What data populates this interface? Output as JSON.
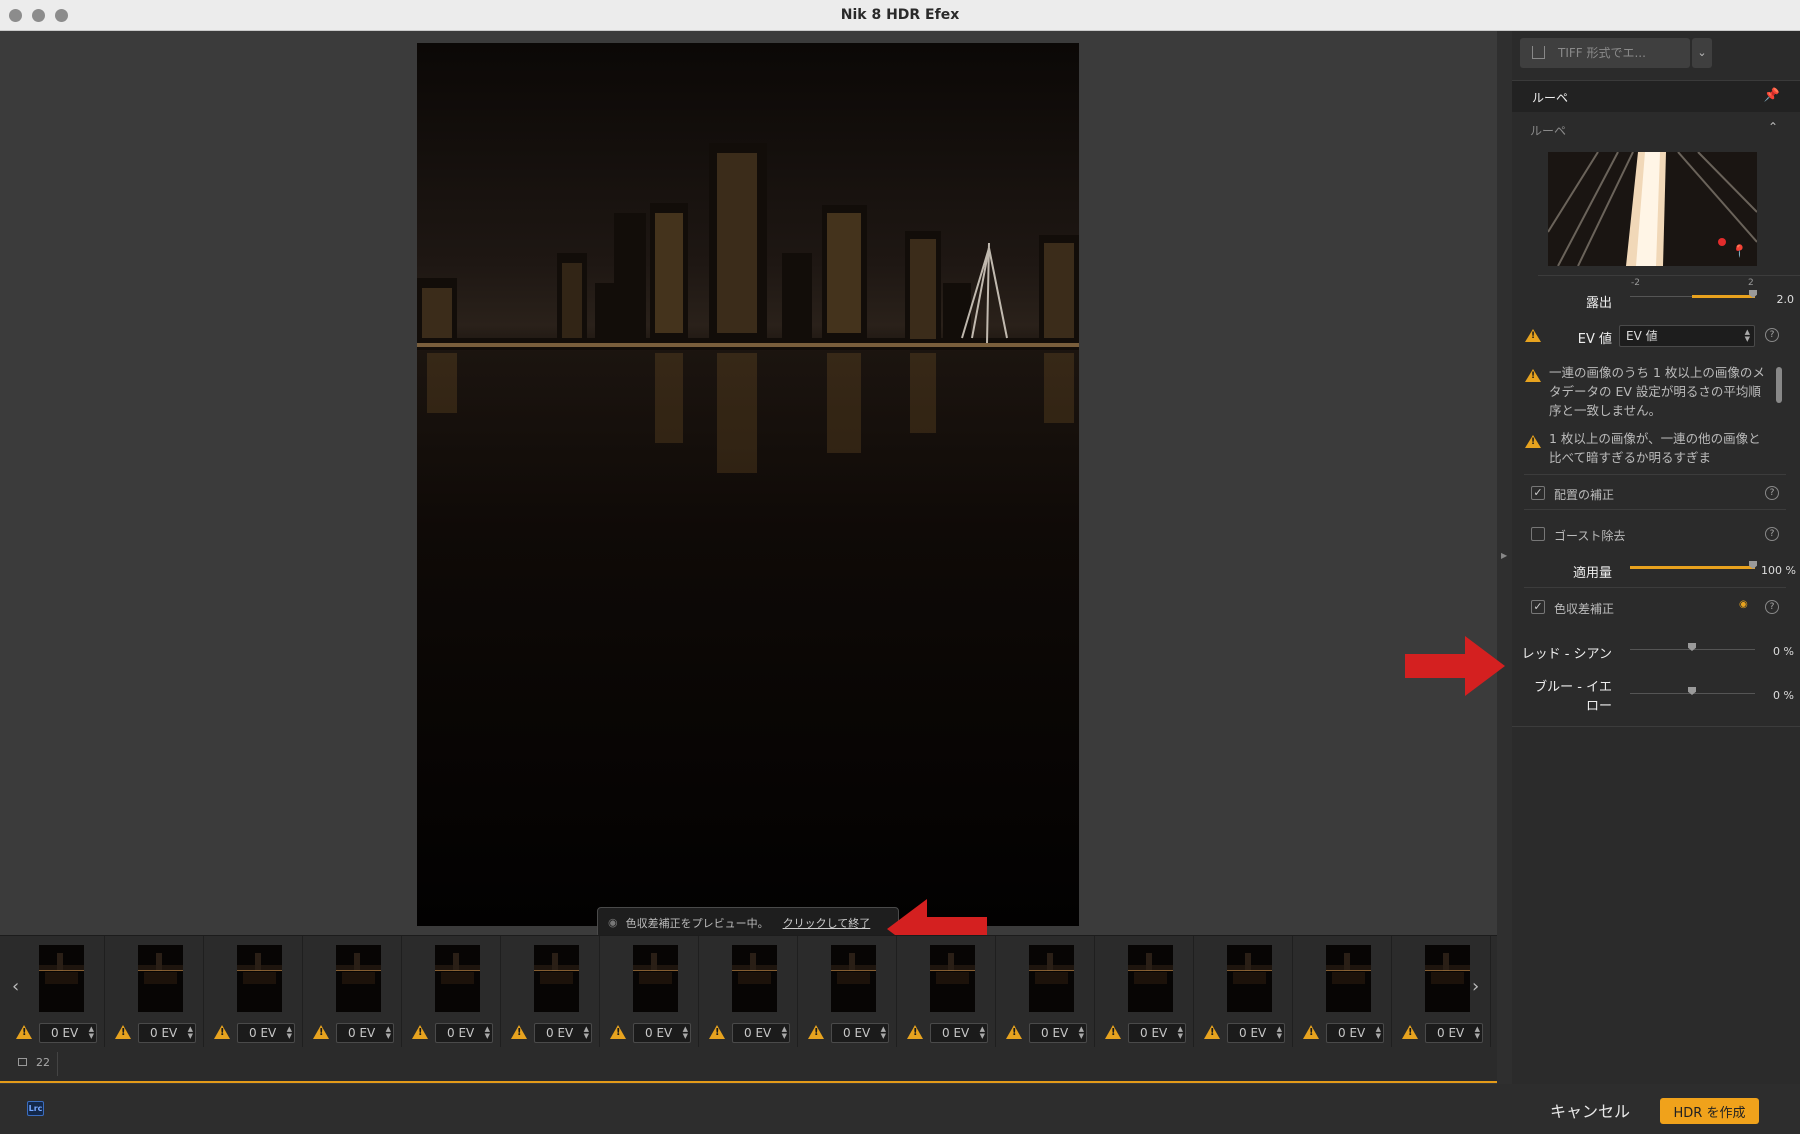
{
  "window": {
    "title": "Nik 8 HDR Efex"
  },
  "preview_notice": {
    "text": "色収差補正をプレビュー中。",
    "link": "クリックして終了"
  },
  "filmstrip": {
    "frames": [
      {
        "ev": "0 EV"
      },
      {
        "ev": "0 EV"
      },
      {
        "ev": "0 EV"
      },
      {
        "ev": "0 EV"
      },
      {
        "ev": "0 EV"
      },
      {
        "ev": "0 EV"
      },
      {
        "ev": "0 EV"
      },
      {
        "ev": "0 EV"
      },
      {
        "ev": "0 EV"
      },
      {
        "ev": "0 EV"
      },
      {
        "ev": "0 EV"
      },
      {
        "ev": "0 EV"
      },
      {
        "ev": "0 EV"
      },
      {
        "ev": "0 EV"
      },
      {
        "ev": "0 EV"
      }
    ]
  },
  "status": {
    "image_count": "22"
  },
  "bottom": {
    "lrc_badge": "Lrc",
    "cancel_label": "キャンセル",
    "create_label": "HDR を作成"
  },
  "panel": {
    "export_label": "TIFF 形式でエ...",
    "header_title": "ルーペ",
    "loupe_section": "ルーペ",
    "exposure": {
      "label": "露出",
      "min_label": "-2",
      "max_label": "2",
      "value": "2.0",
      "level": 1.0
    },
    "ev_value": {
      "label": "EV 値",
      "selected": "EV 値"
    },
    "warnings": [
      "一連の画像のうち 1 枚以上の画像のメタデータの EV 設定が明るさの平均順序と一致しません。",
      "1 枚以上の画像が、一連の他の画像と比べて暗すぎるか明るすぎま"
    ],
    "alignment": {
      "label": "配置の補正",
      "checked": true
    },
    "ghost": {
      "label": "ゴースト除去",
      "checked": false
    },
    "amount": {
      "label": "適用量",
      "value": "100 %",
      "level": 1.0
    },
    "chromatic": {
      "label": "色収差補正",
      "checked": true
    },
    "red_cyan": {
      "label": "レッド - シアン",
      "value": "0 %",
      "level": 0.5
    },
    "blue_yellow": {
      "label_line1": "ブルー - イエ",
      "label_line2": "ロー",
      "value": "0 %",
      "level": 0.5
    }
  },
  "colors": {
    "accent": "#f0a21b",
    "warning": "#e7a31f",
    "annotation_arrow": "#d42020"
  }
}
